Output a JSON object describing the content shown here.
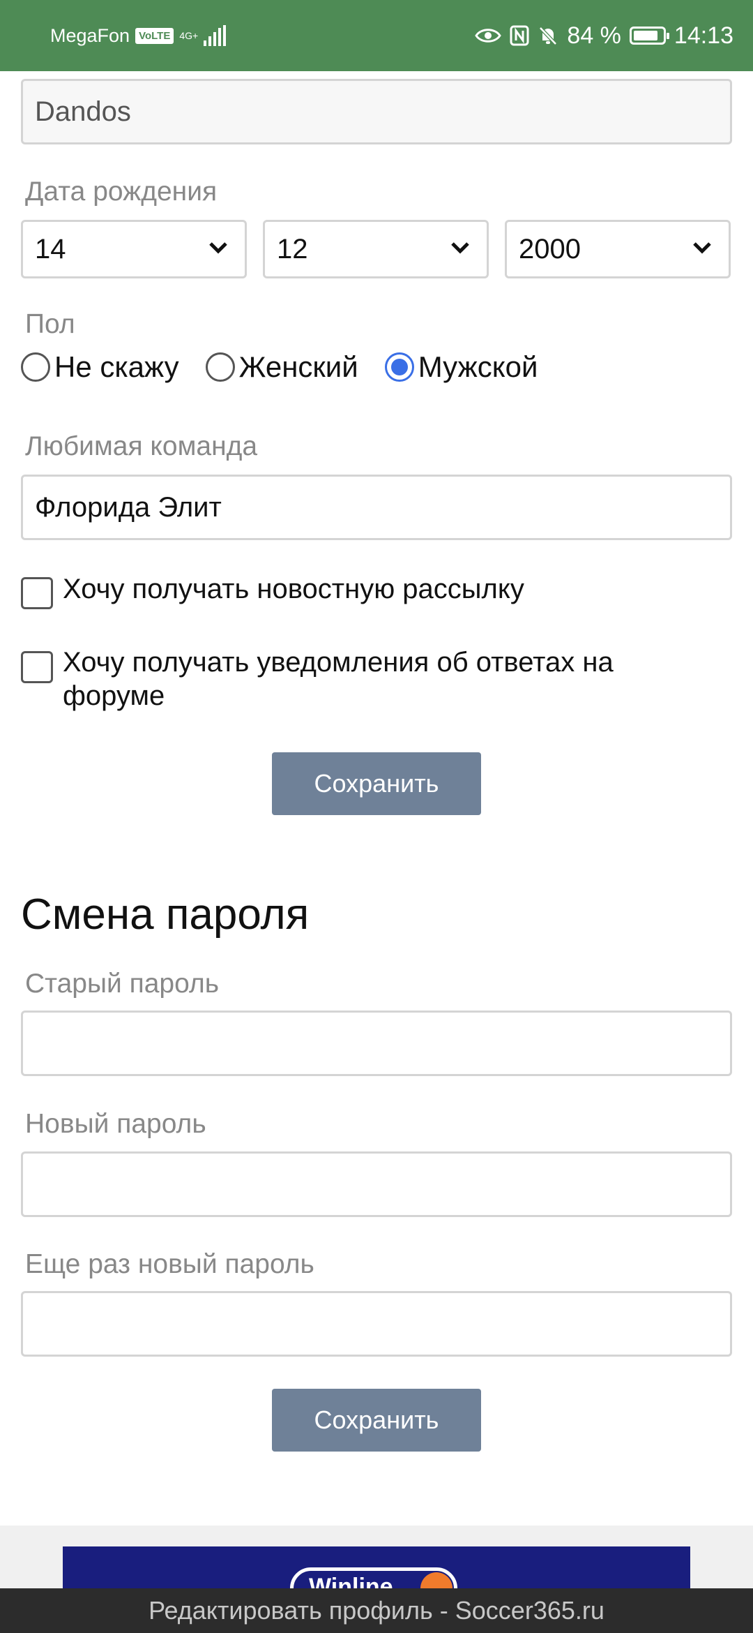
{
  "status_bar": {
    "carrier": "MegaFon",
    "volte": "VoLTE",
    "network": "4G+",
    "battery_percent": "84 %",
    "battery_level": 0.84,
    "time": "14:13",
    "icons": [
      "eye-icon",
      "nfc-icon",
      "bell-off-icon",
      "battery-icon"
    ]
  },
  "profile": {
    "name_value": "Dandos",
    "birth_label": "Дата рождения",
    "birth_day": "14",
    "birth_month": "12",
    "birth_year": "2000",
    "gender_label": "Пол",
    "gender_options": [
      "Не скажу",
      "Женский",
      "Мужской"
    ],
    "gender_selected": "Мужской",
    "team_label": "Любимая команда",
    "team_value": "Флорида Элит",
    "newsletter_label": "Хочу получать новостную рассылку",
    "forum_label_line1": "Хочу получать уведомления об ответах на",
    "forum_label_line2": "форуме",
    "save_label": "Сохранить"
  },
  "password": {
    "title": "Смена пароля",
    "old_label": "Старый пароль",
    "new_label": "Новый пароль",
    "repeat_label": "Еще раз новый пароль",
    "save_label": "Сохранить"
  },
  "ad": {
    "text": "Winline"
  },
  "page_title": "Редактировать профиль - Soccer365.ru",
  "colors": {
    "status_bar": "#4e8b55",
    "button": "#6f8198",
    "radio_selected": "#3a6fe6",
    "ad_background": "#191e7e"
  }
}
